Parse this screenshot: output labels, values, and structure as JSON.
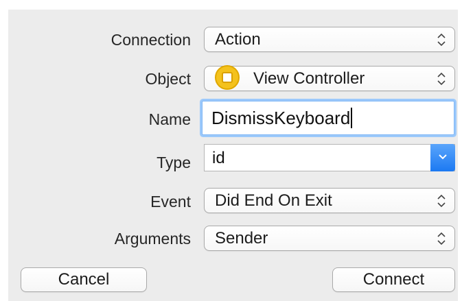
{
  "form": {
    "connection": {
      "label": "Connection",
      "value": "Action"
    },
    "object": {
      "label": "Object",
      "value": "View Controller"
    },
    "name": {
      "label": "Name",
      "value": "DismissKeyboard"
    },
    "type": {
      "label": "Type",
      "value": "id"
    },
    "event": {
      "label": "Event",
      "value": "Did End On Exit"
    },
    "arguments": {
      "label": "Arguments",
      "value": "Sender"
    }
  },
  "buttons": {
    "cancel": "Cancel",
    "connect": "Connect"
  },
  "icons": {
    "popup_arrows": "up-down-chevron-icon",
    "object": "view-controller-icon",
    "combo_arrow": "chevron-down-icon"
  },
  "colors": {
    "background": "#ececec",
    "accent": "#1c79f2",
    "focus_ring": "#9cc9fb",
    "object_icon": "#f4c21d"
  }
}
